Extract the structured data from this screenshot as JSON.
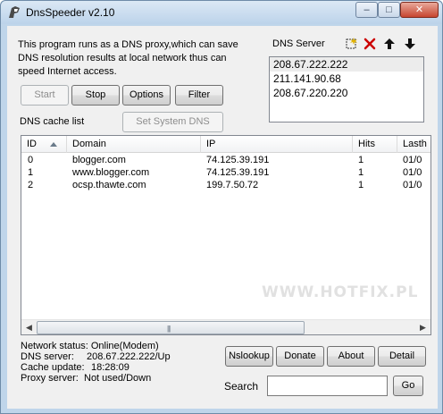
{
  "window": {
    "title": "DnsSpeeder v2.10",
    "controls": {
      "minimize": "–",
      "maximize": "□",
      "close": "✕"
    }
  },
  "description": "This program runs as a DNS proxy,which can save DNS resolution results at local network thus can speed Internet access.",
  "buttons": {
    "start": "Start",
    "stop": "Stop",
    "options": "Options",
    "filter": "Filter",
    "set_system_dns": "Set System DNS",
    "nslookup": "Nslookup",
    "donate": "Donate",
    "about": "About",
    "detail": "Detail",
    "go": "Go"
  },
  "dns_server": {
    "label": "DNS Server",
    "tools": [
      "new-icon",
      "delete-icon",
      "move-up-icon",
      "move-down-icon"
    ],
    "servers": [
      "208.67.222.222",
      "211.141.90.68",
      "208.67.220.220"
    ]
  },
  "cache": {
    "label": "DNS cache list",
    "columns": [
      "ID",
      "Domain",
      "IP",
      "Hits",
      "Lasth"
    ],
    "rows": [
      [
        "0",
        "blogger.com",
        "74.125.39.191",
        "1",
        "01/0"
      ],
      [
        "1",
        "www.blogger.com",
        "74.125.39.191",
        "1",
        "01/0"
      ],
      [
        "2",
        "ocsp.thawte.com",
        "199.7.50.72",
        "1",
        "01/0"
      ]
    ]
  },
  "watermark": "WWW.HOTFIX.PL",
  "status": {
    "network_label": "Network status:",
    "network_value": "Online(Modem)",
    "dns_label": "DNS server:",
    "dns_value": "208.67.222.222/Up",
    "cache_label": "Cache update:",
    "cache_value": "18:28:09",
    "proxy_label": "Proxy server:",
    "proxy_value": "Not used/Down"
  },
  "search": {
    "label": "Search",
    "value": ""
  },
  "colors": {
    "frame": "#bfd5ea",
    "client": "#f0f0f0",
    "close_button": "#c6452f",
    "delete_icon": "#cc0000"
  }
}
